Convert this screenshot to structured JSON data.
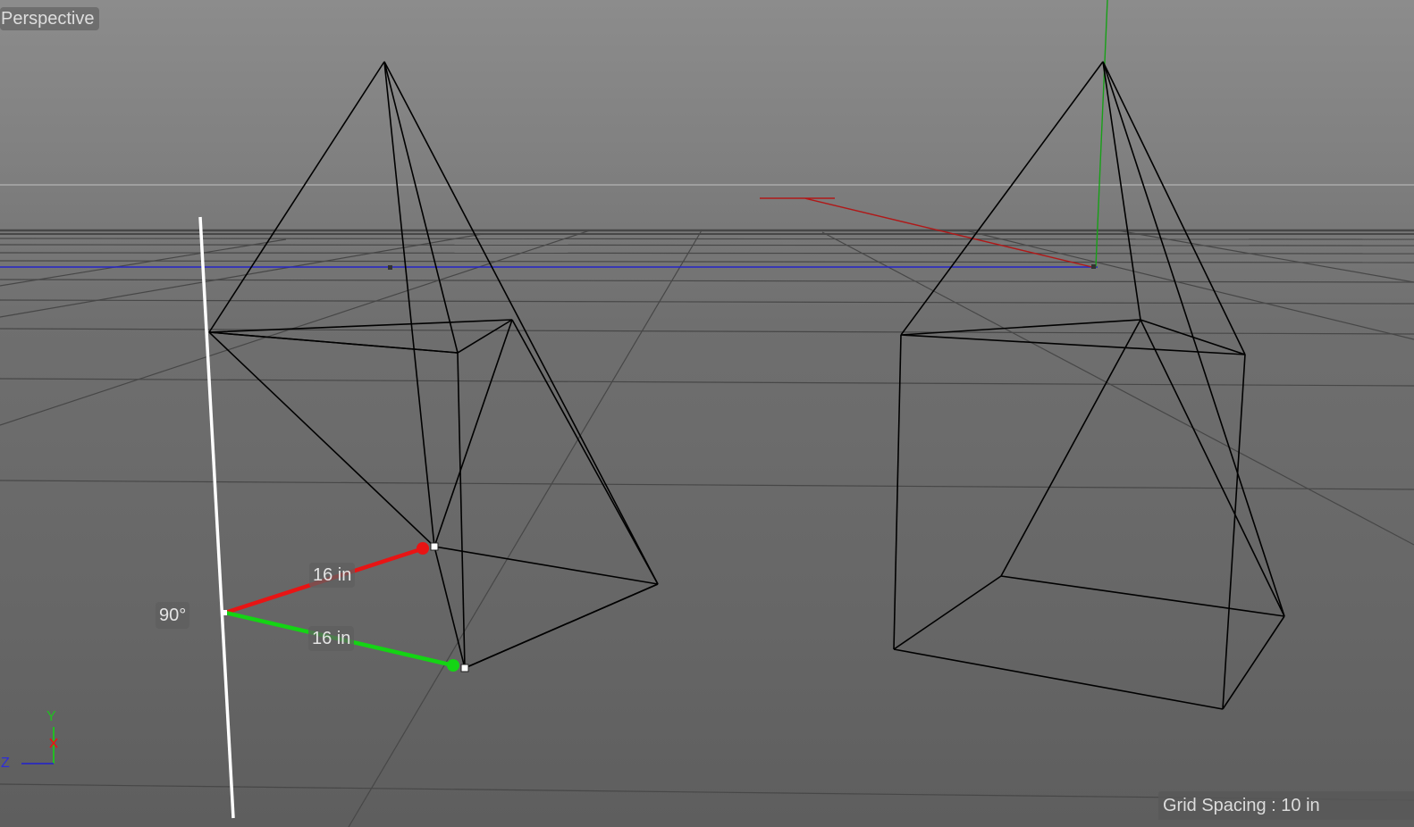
{
  "viewport": {
    "title": "Perspective",
    "grid_spacing": "Grid Spacing : 10 in"
  },
  "measure_tool": {
    "angle": "90°",
    "length_x": "16 in",
    "length_y": "16 in"
  },
  "axis_gizmo": {
    "y_label": "Y",
    "z_label": "Z"
  },
  "colors": {
    "x_axis": "#e81414",
    "y_axis": "#14d414",
    "z_axis": "#2020d0",
    "wireframe": "#000000",
    "grid": "#4a4a4a"
  },
  "objects": [
    {
      "name": "pyramid-left"
    },
    {
      "name": "cube-left"
    },
    {
      "name": "pyramid-right"
    },
    {
      "name": "cube-right"
    }
  ]
}
